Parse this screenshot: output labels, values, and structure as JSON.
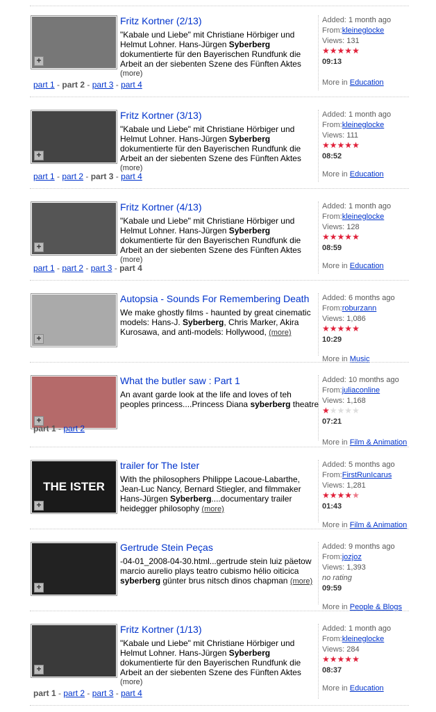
{
  "results": [
    {
      "title": "Fritz Kortner (2/13)",
      "desc_pre": "\"Kabale und Liebe\" mit Christiane Hörbiger und Helmut Lohner. Hans-Jürgen ",
      "desc_bold": "Syberberg",
      "desc_post": " dokumentierte für den Bayerischen Rundfunk die Arbeit an der siebenten Szene des Fünften Aktes",
      "more": "(more)",
      "parts": [
        "part 1",
        "part 2",
        "part 3",
        "part 4"
      ],
      "current_part": 1,
      "added_label": "Added:",
      "added": "1 month ago",
      "from_label": "From:",
      "from": "kleineglocke",
      "views_label": "Views:",
      "views": "131",
      "rating": 5,
      "duration": "09:13",
      "more_in": "More in",
      "category": "Education",
      "thumb_color": "#777"
    },
    {
      "title": "Fritz Kortner (3/13)",
      "desc_pre": "\"Kabale und Liebe\" mit Christiane Hörbiger und Helmut Lohner. Hans-Jürgen ",
      "desc_bold": "Syberberg",
      "desc_post": " dokumentierte für den Bayerischen Rundfunk die Arbeit an der siebenten Szene des Fünften Aktes",
      "more": "(more)",
      "parts": [
        "part 1",
        "part 2",
        "part 3",
        "part 4"
      ],
      "current_part": 2,
      "added_label": "Added:",
      "added": "1 month ago",
      "from_label": "From:",
      "from": "kleineglocke",
      "views_label": "Views:",
      "views": "111",
      "rating": 5,
      "duration": "08:52",
      "more_in": "More in",
      "category": "Education",
      "thumb_color": "#444"
    },
    {
      "title": "Fritz Kortner (4/13)",
      "desc_pre": "\"Kabale und Liebe\" mit Christiane Hörbiger und Helmut Lohner. Hans-Jürgen ",
      "desc_bold": "Syberberg",
      "desc_post": " dokumentierte für den Bayerischen Rundfunk die Arbeit an der siebenten Szene des Fünften Aktes",
      "more": "(more)",
      "parts": [
        "part 1",
        "part 2",
        "part 3",
        "part 4"
      ],
      "current_part": 3,
      "added_label": "Added:",
      "added": "1 month ago",
      "from_label": "From:",
      "from": "kleineglocke",
      "views_label": "Views:",
      "views": "128",
      "rating": 5,
      "duration": "08:59",
      "more_in": "More in",
      "category": "Education",
      "thumb_color": "#555"
    },
    {
      "title": "Autopsia - Sounds For Remembering Death",
      "desc_pre": "We make ghostly films - haunted by great cinematic models: Hans-J. ",
      "desc_bold": "Syberberg",
      "desc_post": ", Chris Marker, Akira Kurosawa, and anti-models: Hollywood, ",
      "more": "(more)",
      "parts": [],
      "current_part": -1,
      "added_label": "Added:",
      "added": "6 months ago",
      "from_label": "From:",
      "from": "roburzann",
      "views_label": "Views:",
      "views": "1,086",
      "rating": 5,
      "duration": "10:29",
      "more_in": "More in",
      "category": "Music",
      "thumb_color": "#aaa"
    },
    {
      "title": "What the butler saw : Part 1",
      "desc_pre": "An avant garde look at the life and loves of teh peoples princess....Princess Diana ",
      "desc_bold": "syberberg",
      "desc_post": " theatre",
      "more": "",
      "parts": [
        "part 1",
        "part 2"
      ],
      "current_part": 0,
      "added_label": "Added:",
      "added": "10 months ago",
      "from_label": "From:",
      "from": "juliaconline",
      "views_label": "Views:",
      "views": "1,168",
      "rating": 1,
      "duration": "07:21",
      "more_in": "More in",
      "category": "Film & Animation",
      "thumb_color": "#b56a6a"
    },
    {
      "title": "trailer for The Ister",
      "desc_pre": "With the philosophers Philippe Lacoue-Labarthe, Jean-Luc Nancy, Bernard Stiegler, and filmmaker Hans-Jürgen ",
      "desc_bold": "Syberberg",
      "desc_post": "....documentary trailer heidegger philosophy ",
      "more": "(more)",
      "parts": [],
      "current_part": -1,
      "added_label": "Added:",
      "added": "5 months ago",
      "from_label": "From:",
      "from": "FirstRunIcarus",
      "views_label": "Views:",
      "views": "1,281",
      "rating": 4.5,
      "duration": "01:43",
      "more_in": "More in",
      "category": "Film & Animation",
      "thumb_color": "#1a1a1a",
      "thumb_text": "THE ISTER"
    },
    {
      "title": "Gertrude Stein Peças",
      "desc_pre": "-04-01_2008-04-30.html...gertrude stein luiz päetow marcio aurelio plays teatro cubismo hélio oiticica ",
      "desc_bold": "syberberg",
      "desc_post": " günter brus nitsch dinos chapman ",
      "more": "(more)",
      "parts": [],
      "current_part": -1,
      "added_label": "Added:",
      "added": "9 months ago",
      "from_label": "From:",
      "from": "jozjoz",
      "views_label": "Views:",
      "views": "1,393",
      "rating": 0,
      "no_rating": "no rating",
      "duration": "09:59",
      "more_in": "More in",
      "category": "People & Blogs",
      "thumb_color": "#222"
    },
    {
      "title": "Fritz Kortner (1/13)",
      "desc_pre": "\"Kabale und Liebe\" mit Christiane Hörbiger und Helmut Lohner. Hans-Jürgen ",
      "desc_bold": "Syberberg",
      "desc_post": " dokumentierte für den Bayerischen Rundfunk die Arbeit an der siebenten Szene des Fünften Aktes",
      "more": "(more)",
      "parts": [
        "part 1",
        "part 2",
        "part 3",
        "part 4"
      ],
      "current_part": 0,
      "added_label": "Added:",
      "added": "1 month ago",
      "from_label": "From:",
      "from": "kleineglocke",
      "views_label": "Views:",
      "views": "284",
      "rating": 5,
      "duration": "08:37",
      "more_in": "More in",
      "category": "Education",
      "thumb_color": "#3a3a3a"
    }
  ]
}
